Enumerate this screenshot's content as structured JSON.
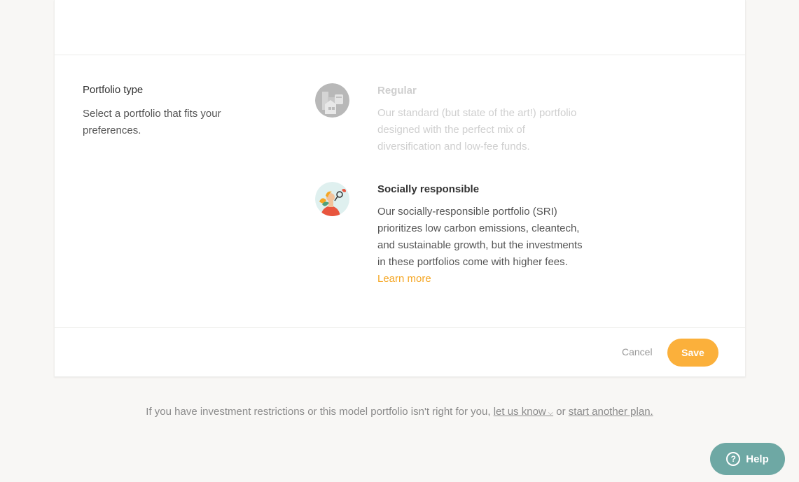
{
  "section": {
    "title": "Portfolio type",
    "description": "Select a portfolio that fits your preferences."
  },
  "options": [
    {
      "name": "Regular",
      "description": "Our standard (but state of the art!) portfolio designed with the perfect mix of diversification and low-fee funds.",
      "icon": "city-buildings-icon",
      "state": "unselected"
    },
    {
      "name": "Socially responsible",
      "description": "Our socially-responsible portfolio (SRI) prioritizes low carbon emissions, cleantech, and sustainable growth, but the investments in these portfolios come with higher fees.",
      "link_label": "Learn more",
      "icon": "person-with-plant-icon",
      "state": "selected"
    }
  ],
  "actions": {
    "cancel_label": "Cancel",
    "save_label": "Save"
  },
  "note": {
    "prefix": "If you have investment restrictions or this model portfolio isn't right for you,",
    "link1": "let us know",
    "middle": "or",
    "link2": "start another plan."
  },
  "help": {
    "label": "Help",
    "icon": "question-circle-icon"
  },
  "colors": {
    "accent": "#fbb03b",
    "link": "#f5a623",
    "help_bg": "#6ea8a4",
    "page_bg": "#f8f7f5"
  }
}
